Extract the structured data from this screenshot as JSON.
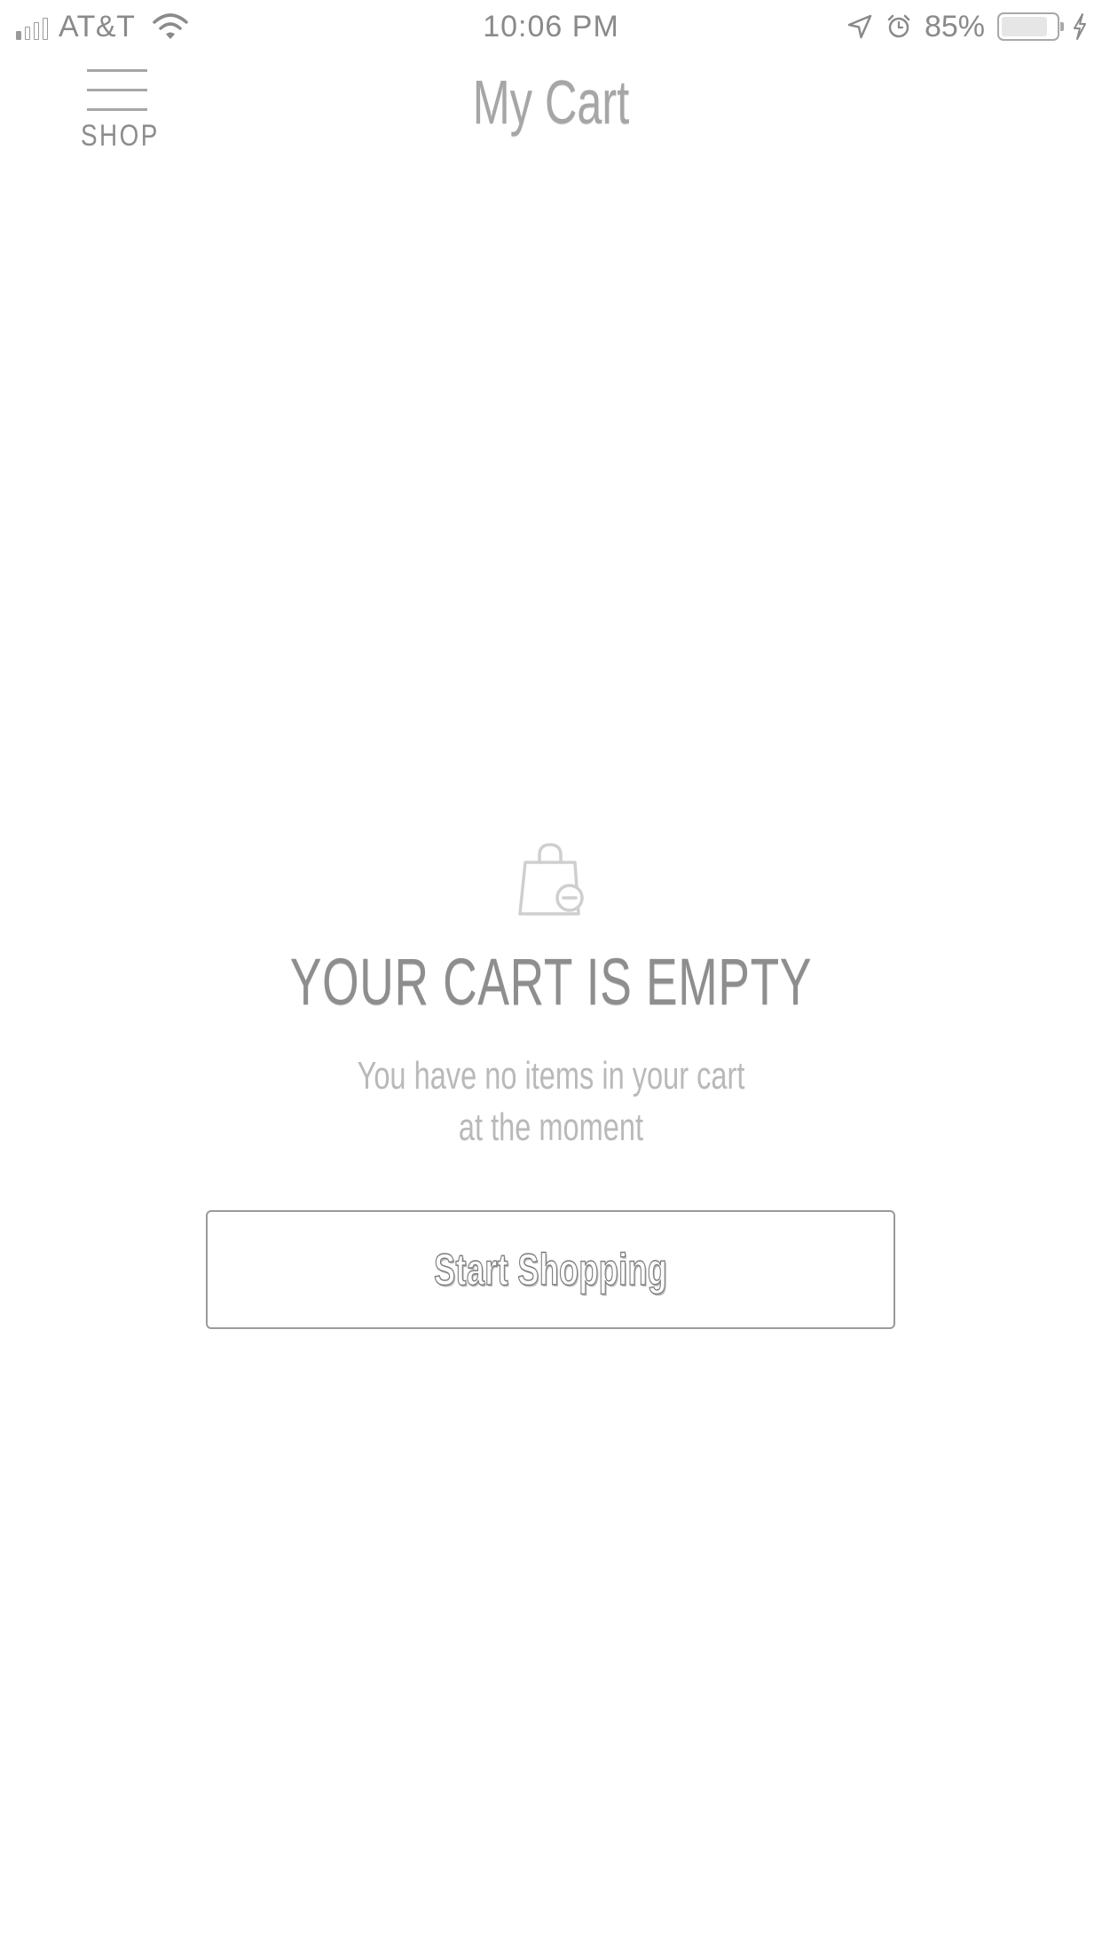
{
  "status_bar": {
    "carrier": "AT&T",
    "time": "10:06 PM",
    "battery_percent": "85%",
    "battery_level": 0.85,
    "icons": [
      "signal-icon",
      "wifi-icon",
      "location-arrow-icon",
      "alarm-icon",
      "battery-icon",
      "charging-bolt-icon"
    ]
  },
  "header": {
    "menu_label": "SHOP",
    "menu_icon": "hamburger-menu-icon",
    "title": "My Cart"
  },
  "empty_state": {
    "icon": "shopping-bag-minus-icon",
    "title": "YOUR CART IS EMPTY",
    "message_line1": "You have no items in your cart",
    "message_line2": "at the moment",
    "button_label": "Start Shopping"
  },
  "colors": {
    "background": "#ffffff",
    "text_muted": "#b9b9b9",
    "text_heading": "#8e8e8e",
    "border": "#9a9a9a"
  }
}
